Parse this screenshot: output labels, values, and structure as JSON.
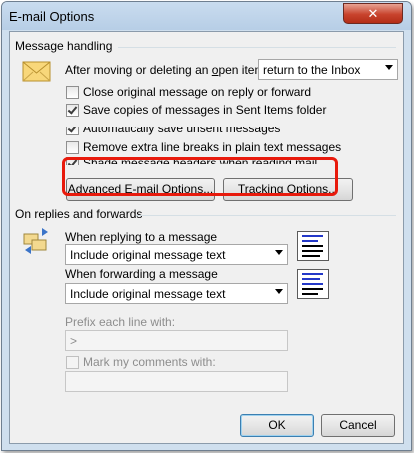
{
  "window": {
    "title": "E-mail Options",
    "close_symbol": "✕"
  },
  "message_handling": {
    "title": "Message handling",
    "after_moving_label": "After moving or deleting an open item:",
    "after_moving_value": "return to the Inbox",
    "close_original_label": "Close original message on reply or forward",
    "close_original_checked": false,
    "save_copies_label": "Save copies of messages in Sent Items folder",
    "save_copies_checked": true,
    "autosave_label": "Automatically save unsent messages",
    "autosave_checked": true,
    "remove_breaks_label": "Remove extra line breaks in plain text messages",
    "remove_breaks_checked": false,
    "shade_headers_label": "Shade message headers when reading mail",
    "shade_headers_checked": true,
    "advanced_button": "Advanced E-mail Options...",
    "tracking_button": "Tracking Options..."
  },
  "replies": {
    "title": "On replies and forwards",
    "replying_label": "When replying to a message",
    "replying_value": "Include original message text",
    "forwarding_label": "When forwarding a message",
    "forwarding_value": "Include original message text",
    "prefix_label": "Prefix each line with:",
    "prefix_value": ">",
    "mark_label": "Mark my comments with:",
    "mark_checked": false,
    "mark_value": ""
  },
  "buttons": {
    "ok": "OK",
    "cancel": "Cancel"
  },
  "icons": {
    "envelope": "envelope-icon",
    "reply_forward": "reply-forward-icon"
  },
  "colors": {
    "highlight": "#e81a0c",
    "preview_lines": "#2438c8"
  }
}
